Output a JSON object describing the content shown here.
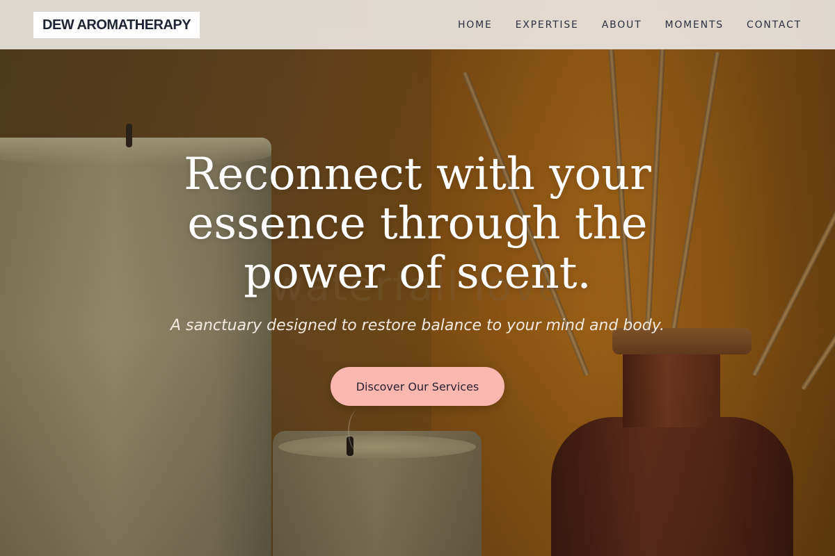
{
  "header": {
    "logo": "DEW AROMATHERAPY",
    "nav": [
      {
        "label": "HOME"
      },
      {
        "label": "EXPERTISE"
      },
      {
        "label": "ABOUT"
      },
      {
        "label": "MOMENTS"
      },
      {
        "label": "CONTACT"
      }
    ]
  },
  "hero": {
    "watermark": "waterfall love",
    "title": "Reconnect with your essence through the power of scent.",
    "subtitle": "A sanctuary designed to restore balance to your mind and body.",
    "cta_label": "Discover Our Services"
  },
  "colors": {
    "header_bg": "#e8e2dc",
    "logo_text": "#1e2433",
    "cta_bg": "#fbb8b0",
    "hero_text": "#ffffff"
  }
}
